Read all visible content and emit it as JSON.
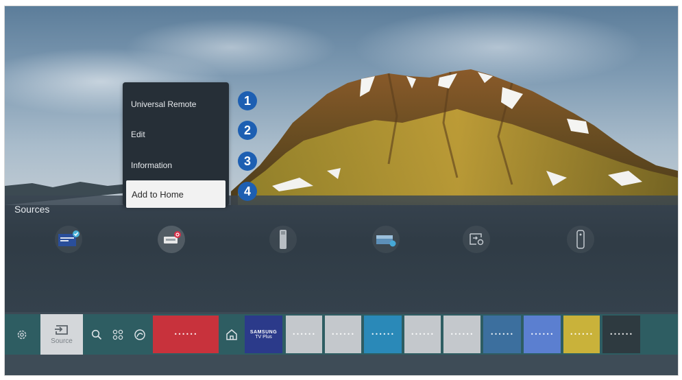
{
  "context_menu": {
    "items": [
      {
        "label": "Universal Remote",
        "callout": "1"
      },
      {
        "label": "Edit",
        "callout": "2"
      },
      {
        "label": "Information",
        "callout": "3"
      },
      {
        "label": "Add to Home",
        "callout": "4",
        "selected": true
      }
    ]
  },
  "sources": {
    "title": "Sources",
    "items": [
      {
        "icon": "samsung-tv-plus-icon",
        "badge": "check"
      },
      {
        "icon": "hdmi-icon",
        "badge": "active"
      },
      {
        "icon": "usb-icon"
      },
      {
        "icon": "screen-mirroring-icon"
      },
      {
        "icon": "connection-guide-icon"
      },
      {
        "icon": "remote-icon"
      }
    ]
  },
  "bottom_bar": {
    "settings_icon": "gear-icon",
    "source_label": "Source",
    "search_icon": "search-icon",
    "apps_icon": "apps-icon",
    "ambient_icon": "ambient-icon",
    "home_icon": "home-icon",
    "tv_plus_logo": [
      "SAMSUNG",
      "TV Plus"
    ],
    "app_tiles": [
      {
        "label": "••••••",
        "color": "#c8323c"
      },
      {
        "label": "••••••",
        "color": "#c4c8cc"
      },
      {
        "label": "••••••",
        "color": "#c4c8cc"
      },
      {
        "label": "••••••",
        "color": "#2a89b8"
      },
      {
        "label": "••••••",
        "color": "#c4c8cc"
      },
      {
        "label": "••••••",
        "color": "#c4c8cc"
      },
      {
        "label": "••••••",
        "color": "#3c6f9e"
      },
      {
        "label": "••••••",
        "color": "#5b7fd0"
      },
      {
        "label": "••••••",
        "color": "#c9b23a"
      },
      {
        "label": "••••••",
        "color": "#2e3a40"
      }
    ]
  },
  "colors": {
    "callout": "#1d5fb2",
    "menu_bg": "#262f37",
    "bar_bg": "#2e5d62"
  }
}
